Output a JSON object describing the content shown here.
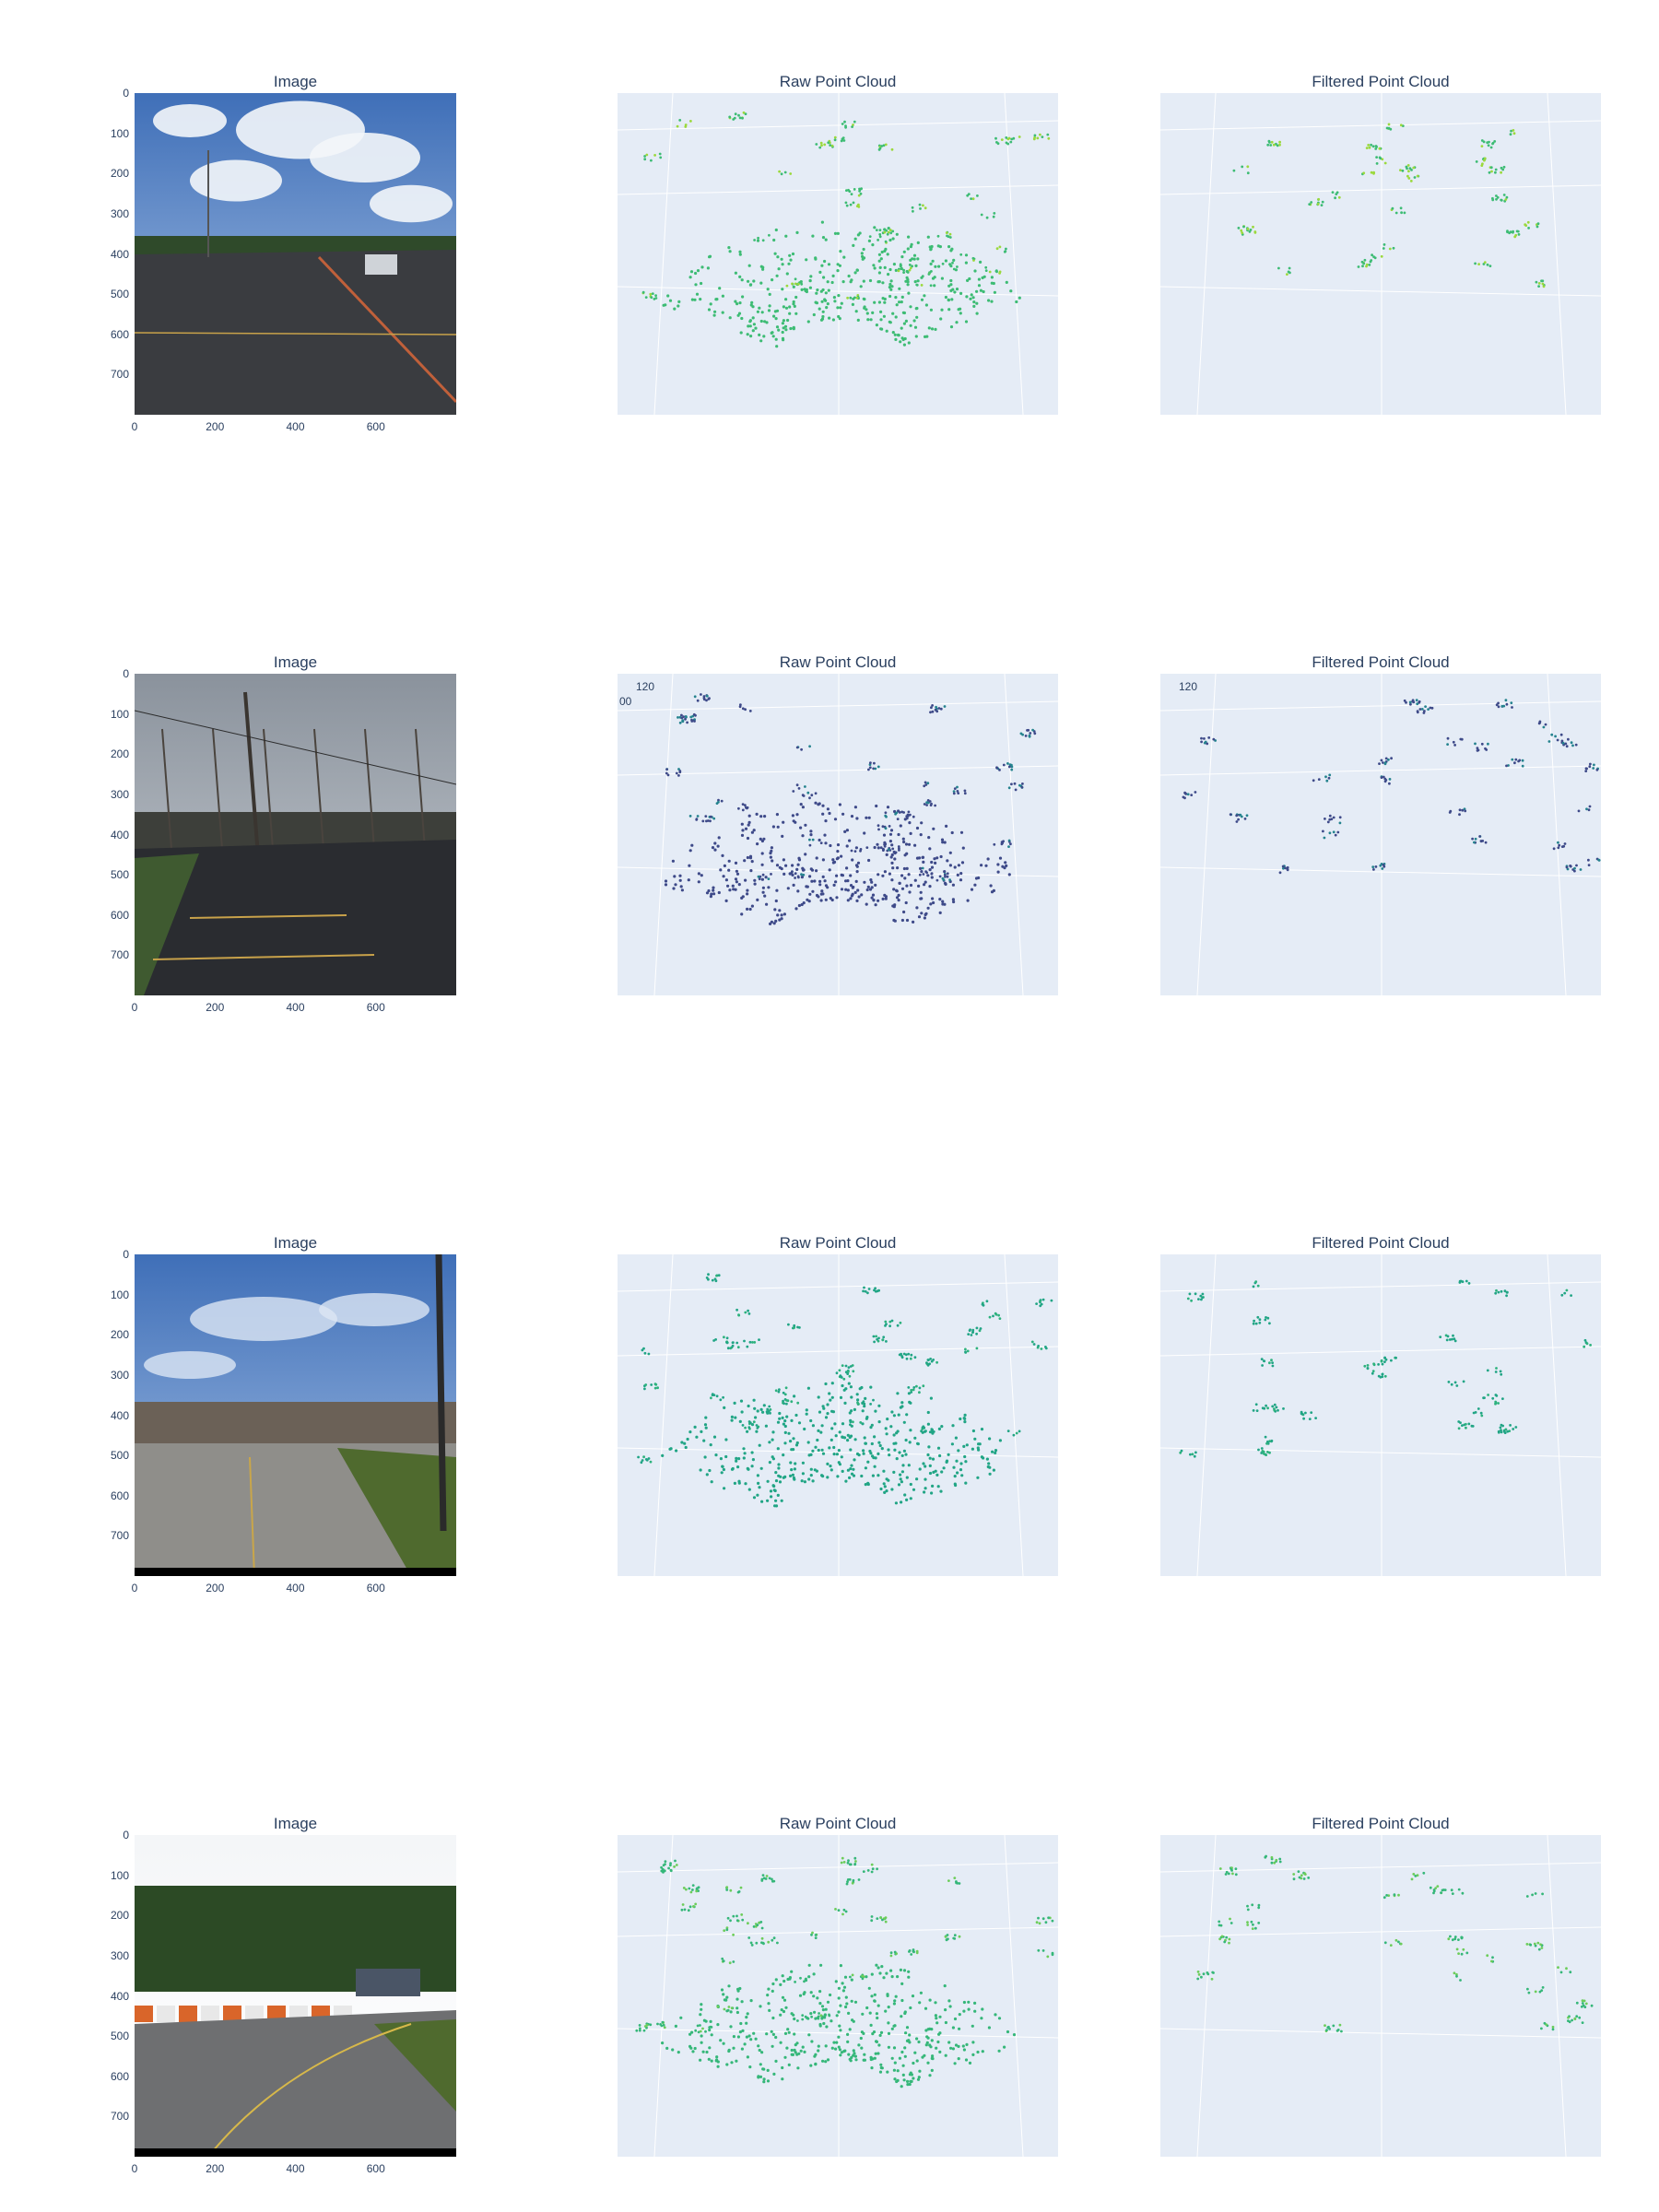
{
  "figure": {
    "rows": [
      {
        "titles": {
          "image": "Image",
          "raw": "Raw Point Cloud",
          "filtered": "Filtered Point Cloud"
        },
        "scene": "parking-lot",
        "point_color": "#3dbc74",
        "point_color_alt": "#9bd93c",
        "axis_annotations": []
      },
      {
        "titles": {
          "image": "Image",
          "raw": "Raw Point Cloud",
          "filtered": "Filtered Point Cloud"
        },
        "scene": "residential-road",
        "point_color": "#3e4a89",
        "point_color_alt": "#25838e",
        "axis_annotations": [
          "120",
          "00"
        ]
      },
      {
        "titles": {
          "image": "Image",
          "raw": "Raw Point Cloud",
          "filtered": "Filtered Point Cloud"
        },
        "scene": "intersection",
        "point_color": "#21a585",
        "point_color_alt": "#2db27d",
        "axis_annotations": []
      },
      {
        "titles": {
          "image": "Image",
          "raw": "Raw Point Cloud",
          "filtered": "Filtered Point Cloud"
        },
        "scene": "curved-road-barriers",
        "point_color": "#35b779",
        "point_color_alt": "#6ccd5a",
        "axis_annotations": []
      }
    ]
  },
  "chart_data": [
    {
      "type": "heatmap",
      "title": "Image",
      "x_ticks": [
        "0",
        "200",
        "400",
        "600"
      ],
      "y_ticks": [
        "0",
        "100",
        "200",
        "300",
        "400",
        "500",
        "600",
        "700"
      ],
      "xlim": [
        0,
        800
      ],
      "ylim": [
        800,
        0
      ]
    },
    {
      "type": "scatter",
      "title": "Raw Point Cloud"
    },
    {
      "type": "scatter",
      "title": "Filtered Point Cloud"
    },
    {
      "type": "heatmap",
      "title": "Image",
      "x_ticks": [
        "0",
        "200",
        "400",
        "600"
      ],
      "y_ticks": [
        "0",
        "100",
        "200",
        "300",
        "400",
        "500",
        "600",
        "700"
      ],
      "xlim": [
        0,
        800
      ],
      "ylim": [
        800,
        0
      ]
    },
    {
      "type": "scatter",
      "title": "Raw Point Cloud",
      "annotations": [
        "120",
        "00"
      ]
    },
    {
      "type": "scatter",
      "title": "Filtered Point Cloud",
      "annotations": [
        "120"
      ]
    },
    {
      "type": "heatmap",
      "title": "Image",
      "x_ticks": [
        "0",
        "200",
        "400",
        "600"
      ],
      "y_ticks": [
        "0",
        "100",
        "200",
        "300",
        "400",
        "500",
        "600",
        "700"
      ],
      "xlim": [
        0,
        800
      ],
      "ylim": [
        800,
        0
      ]
    },
    {
      "type": "scatter",
      "title": "Raw Point Cloud"
    },
    {
      "type": "scatter",
      "title": "Filtered Point Cloud"
    },
    {
      "type": "heatmap",
      "title": "Image",
      "x_ticks": [
        "0",
        "200",
        "400",
        "600"
      ],
      "y_ticks": [
        "0",
        "100",
        "200",
        "300",
        "400",
        "500",
        "600",
        "700"
      ],
      "xlim": [
        0,
        800
      ],
      "ylim": [
        800,
        0
      ]
    },
    {
      "type": "scatter",
      "title": "Raw Point Cloud"
    },
    {
      "type": "scatter",
      "title": "Filtered Point Cloud"
    }
  ]
}
